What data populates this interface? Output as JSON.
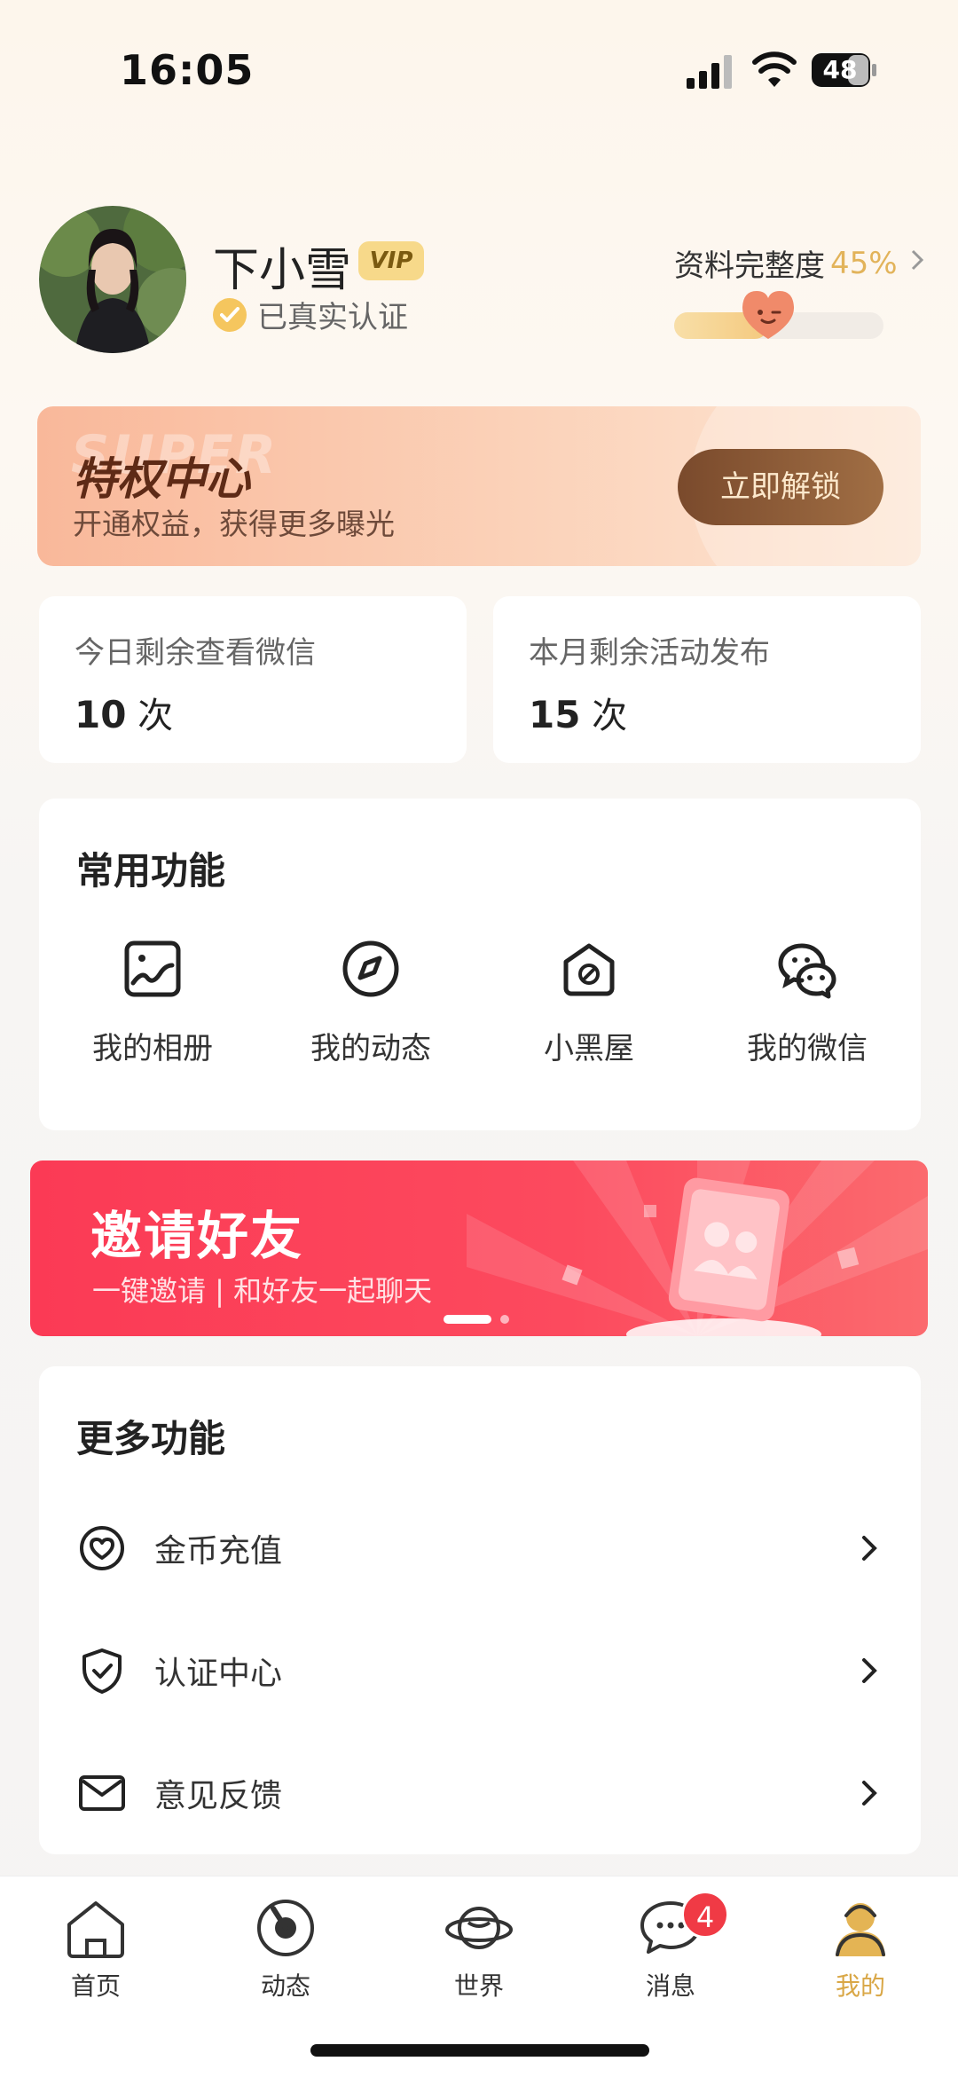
{
  "status_bar": {
    "time": "16:05",
    "battery": "48"
  },
  "profile": {
    "name": "下小雪",
    "vip_badge": "VIP",
    "verified_text": "已真实认证",
    "completeness_label": "资料完整度",
    "completeness_percent": "45%",
    "completeness_value": 0.45
  },
  "privilege": {
    "bg_text": "SUPER",
    "title": "特权中心",
    "subtitle": "开通权益，获得更多曝光",
    "button": "立即解锁"
  },
  "quota": [
    {
      "label": "今日剩余查看微信",
      "value": "10",
      "unit": "次"
    },
    {
      "label": "本月剩余活动发布",
      "value": "15",
      "unit": "次"
    }
  ],
  "common_functions": {
    "title": "常用功能",
    "items": [
      {
        "label": "我的相册",
        "icon": "album-icon"
      },
      {
        "label": "我的动态",
        "icon": "compass-icon"
      },
      {
        "label": "小黑屋",
        "icon": "blocked-house-icon"
      },
      {
        "label": "我的微信",
        "icon": "wechat-icon"
      }
    ]
  },
  "invite_banner": {
    "title": "邀请好友",
    "subtitle": "一键邀请 | 和好友一起聊天"
  },
  "more_functions": {
    "title": "更多功能",
    "items": [
      {
        "label": "金币充值",
        "icon": "heart-coin-icon"
      },
      {
        "label": "认证中心",
        "icon": "shield-check-icon"
      },
      {
        "label": "意见反馈",
        "icon": "mail-icon"
      }
    ]
  },
  "tabbar": {
    "items": [
      {
        "label": "首页",
        "icon": "home-icon"
      },
      {
        "label": "动态",
        "icon": "dynamic-icon"
      },
      {
        "label": "世界",
        "icon": "planet-icon"
      },
      {
        "label": "消息",
        "icon": "message-icon",
        "badge": "4"
      },
      {
        "label": "我的",
        "icon": "profile-icon",
        "active": true
      }
    ]
  },
  "colors": {
    "accent_gold": "#d9a746",
    "invite_red": "#fb3a55",
    "badge_red": "#f03a45"
  }
}
